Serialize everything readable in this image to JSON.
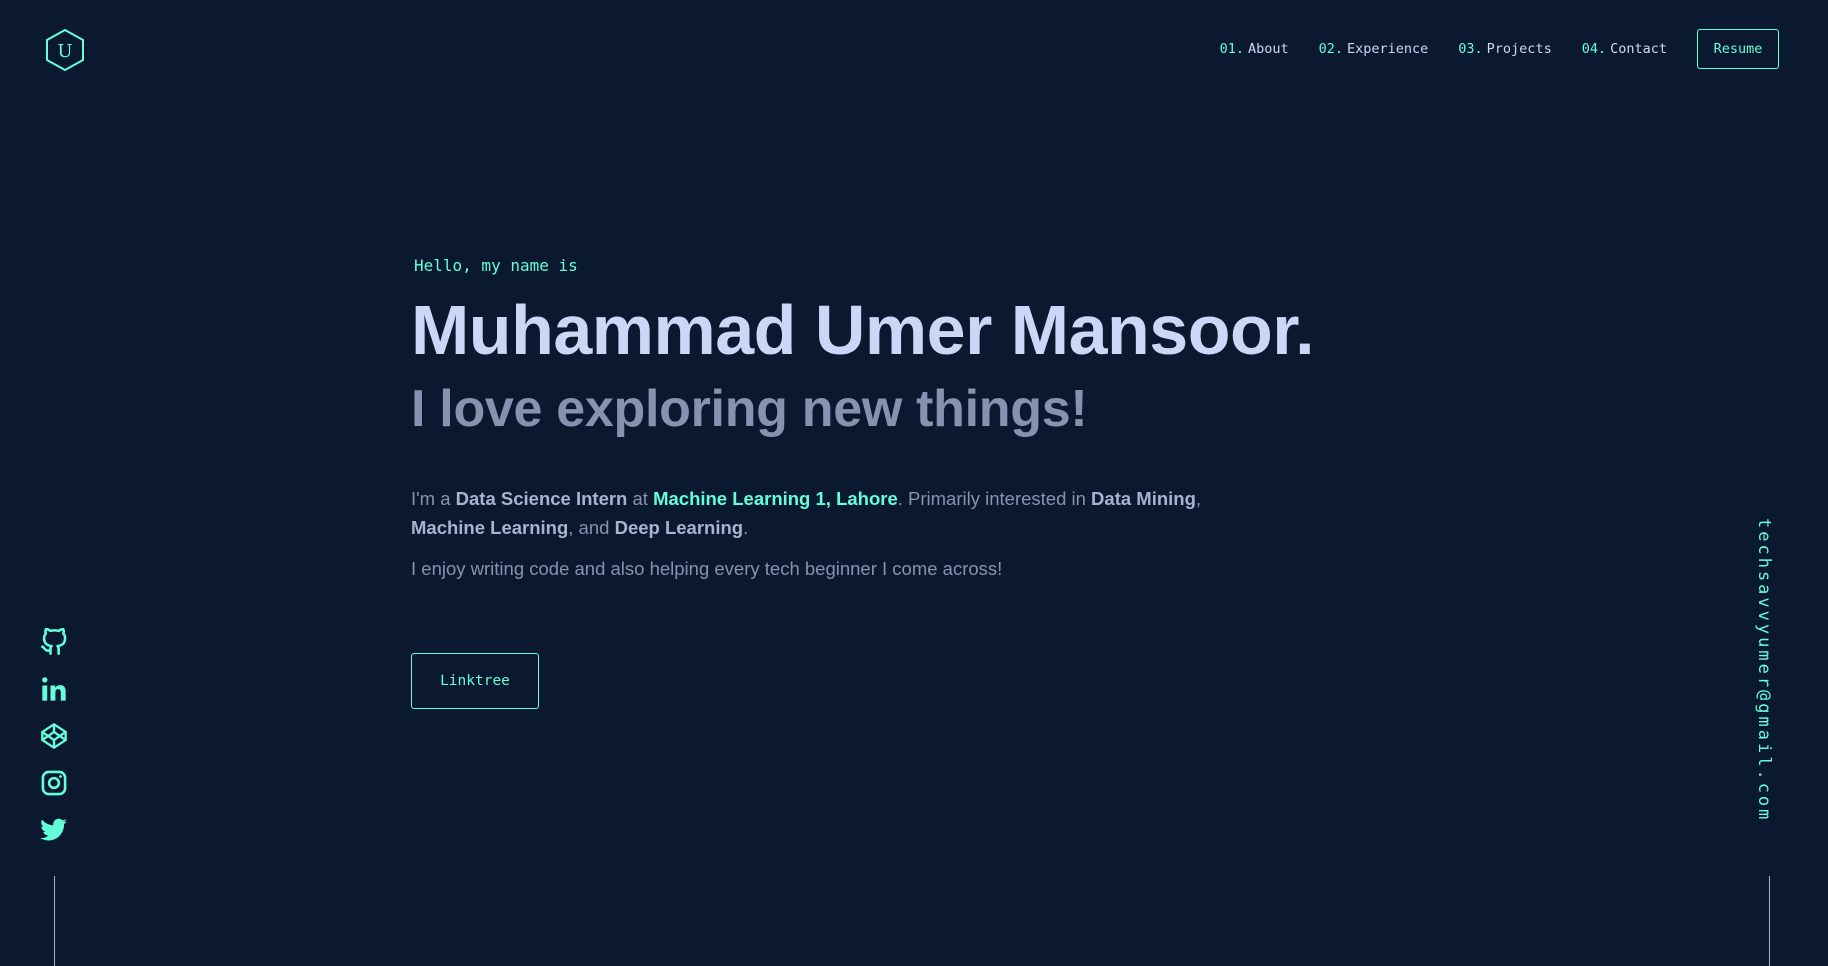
{
  "logo": {
    "letter": "U",
    "icon": "hexagon-logo-icon"
  },
  "nav": {
    "items": [
      {
        "num": "01.",
        "label": "About"
      },
      {
        "num": "02.",
        "label": "Experience"
      },
      {
        "num": "03.",
        "label": "Projects"
      },
      {
        "num": "04.",
        "label": "Contact"
      }
    ],
    "resume_label": "Resume"
  },
  "hero": {
    "greeting": "Hello, my name is",
    "name": "Muhammad Umer Mansoor.",
    "tagline": "I love exploring new things!",
    "intro": {
      "p1": "I'm a ",
      "role": "Data Science Intern",
      "p2": " at ",
      "company": "Machine Learning 1, Lahore",
      "p3": ". Primarily interested in ",
      "interest1": "Data Mining",
      "p4": ", ",
      "interest2": "Machine Learning",
      "p5": ", and ",
      "interest3": "Deep Learning",
      "p6": "."
    },
    "intro2": "I enjoy writing code and also helping every tech beginner I come across!",
    "button_label": "Linktree"
  },
  "social": [
    "github-icon",
    "linkedin-icon",
    "codepen-icon",
    "instagram-icon",
    "twitter-icon"
  ],
  "email": "techsavvyumer@gmail.com",
  "colors": {
    "background": "#0a192f",
    "accent": "#64ffda",
    "lightest_slate": "#ccd6f6",
    "slate": "#8892b0",
    "light_slate": "#a8b2d1"
  }
}
